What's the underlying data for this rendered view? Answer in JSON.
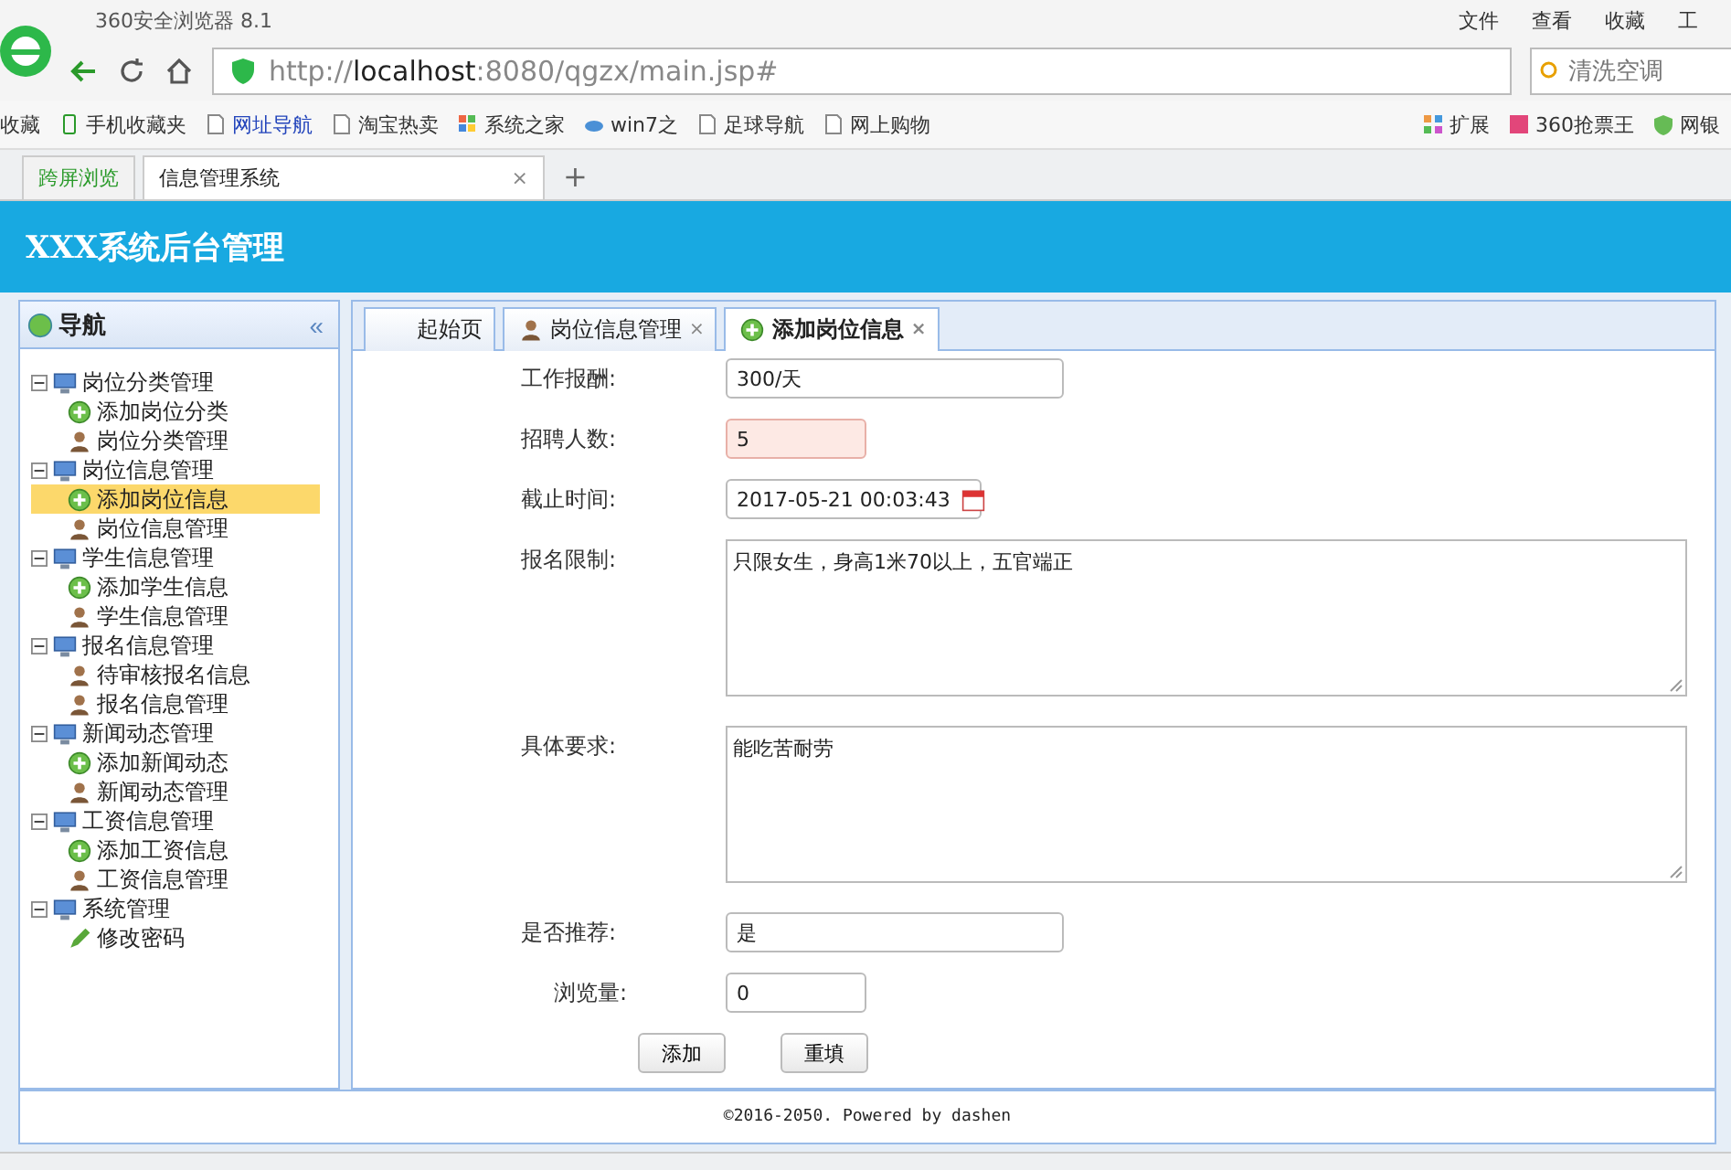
{
  "browser": {
    "title": "360安全浏览器 8.1",
    "menu": [
      "文件",
      "查看",
      "收藏",
      "工"
    ],
    "address": {
      "prefix": "http://",
      "host": "localhost",
      "rest": ":8080/qgzx/main.jsp#"
    },
    "search": {
      "placeholder": "清洗空调"
    },
    "bookmarks": [
      {
        "label": "收藏",
        "kind": "menu"
      },
      {
        "label": "手机收藏夹",
        "kind": "phone"
      },
      {
        "label": "网址导航",
        "kind": "link"
      },
      {
        "label": "淘宝热卖",
        "kind": "page"
      },
      {
        "label": "系统之家",
        "kind": "logo"
      },
      {
        "label": "win7之",
        "kind": "cloud"
      },
      {
        "label": "足球导航",
        "kind": "page"
      },
      {
        "label": "网上购物",
        "kind": "page"
      }
    ],
    "bookmarks_right": [
      {
        "label": "扩展",
        "kind": "grid"
      },
      {
        "label": "360抢票王",
        "kind": "ticket"
      },
      {
        "label": "网银",
        "kind": "shield"
      }
    ],
    "tabs": [
      {
        "label": "跨屏浏览",
        "selected": false
      },
      {
        "label": "信息管理系统",
        "selected": true,
        "close": "×"
      }
    ],
    "new_tab": "+"
  },
  "app": {
    "title": "XXX系统后台管理",
    "nav": {
      "title": "导航",
      "collapse": "«",
      "groups": [
        {
          "label": "岗位分类管理",
          "expanded": true,
          "children": [
            {
              "label": "添加岗位分类",
              "kind": "add",
              "selected": false
            },
            {
              "label": "岗位分类管理",
              "kind": "user",
              "selected": false
            }
          ]
        },
        {
          "label": "岗位信息管理",
          "expanded": true,
          "children": [
            {
              "label": "添加岗位信息",
              "kind": "add",
              "selected": true
            },
            {
              "label": "岗位信息管理",
              "kind": "user",
              "selected": false
            }
          ]
        },
        {
          "label": "学生信息管理",
          "expanded": true,
          "children": [
            {
              "label": "添加学生信息",
              "kind": "add",
              "selected": false
            },
            {
              "label": "学生信息管理",
              "kind": "user",
              "selected": false
            }
          ]
        },
        {
          "label": "报名信息管理",
          "expanded": true,
          "children": [
            {
              "label": "待审核报名信息",
              "kind": "user",
              "selected": false
            },
            {
              "label": "报名信息管理",
              "kind": "user",
              "selected": false
            }
          ]
        },
        {
          "label": "新闻动态管理",
          "expanded": true,
          "children": [
            {
              "label": "添加新闻动态",
              "kind": "add",
              "selected": false
            },
            {
              "label": "新闻动态管理",
              "kind": "user",
              "selected": false
            }
          ]
        },
        {
          "label": "工资信息管理",
          "expanded": true,
          "children": [
            {
              "label": "添加工资信息",
              "kind": "add",
              "selected": false
            },
            {
              "label": "工资信息管理",
              "kind": "user",
              "selected": false
            }
          ]
        },
        {
          "label": "系统管理",
          "expanded": true,
          "children": [
            {
              "label": "修改密码",
              "kind": "edit",
              "selected": false
            }
          ]
        }
      ]
    },
    "tabs": [
      {
        "label": "起始页",
        "kind": "home",
        "selected": false
      },
      {
        "label": "岗位信息管理",
        "kind": "user",
        "selected": false,
        "close": "×"
      },
      {
        "label": "添加岗位信息",
        "kind": "add",
        "selected": true,
        "close": "×"
      }
    ],
    "form": [
      {
        "label": "工作报酬:",
        "kind": "wide",
        "value": "300/天",
        "highlighted": false
      },
      {
        "label": "招聘人数:",
        "kind": "short",
        "value": "5",
        "highlighted": true
      },
      {
        "label": "截止时间:",
        "kind": "date",
        "value": "2017-05-21 00:03:43",
        "highlighted": false
      },
      {
        "label": "报名限制:",
        "kind": "textarea",
        "value": "只限女生，身高1米70以上，五官端正",
        "highlighted": false
      },
      {
        "label": "具体要求:",
        "kind": "textarea",
        "value": "能吃苦耐劳",
        "highlighted": false
      },
      {
        "label": "是否推荐:",
        "kind": "wide",
        "value": "是",
        "highlighted": false
      },
      {
        "label": "浏览量:",
        "kind": "short",
        "value": "0",
        "highlighted": false
      }
    ],
    "buttons": [
      "添加",
      "重填"
    ],
    "footer": "©2016-2050. Powered by dashen"
  }
}
